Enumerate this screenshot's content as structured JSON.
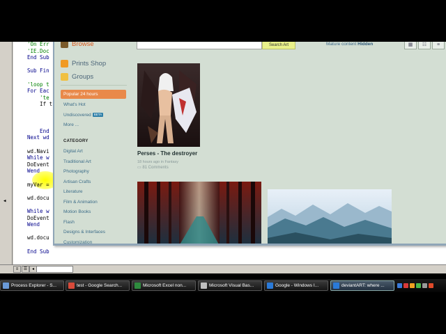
{
  "vba": {
    "lines": [
      {
        "text": "'On Err",
        "style": "comment"
      },
      {
        "text": "'IE.Doc",
        "style": "comment"
      },
      {
        "text": "End Sub",
        "style": "kw"
      },
      {
        "text": "",
        "style": ""
      },
      {
        "text": "Sub Fin",
        "style": "kw"
      },
      {
        "text": "",
        "style": ""
      },
      {
        "text": "'loop t",
        "style": "comment"
      },
      {
        "text": "For Eac",
        "style": "kw"
      },
      {
        "text": "    'te",
        "style": "comment"
      },
      {
        "text": "    If t",
        "style": ""
      },
      {
        "text": "",
        "style": ""
      },
      {
        "text": "",
        "style": ""
      },
      {
        "text": "",
        "style": ""
      },
      {
        "text": "    End",
        "style": "kw"
      },
      {
        "text": "Next wd",
        "style": "kw"
      },
      {
        "text": "",
        "style": ""
      },
      {
        "text": "wd.Navi",
        "style": ""
      },
      {
        "text": "While w",
        "style": "kw"
      },
      {
        "text": "DoEvent",
        "style": ""
      },
      {
        "text": "Wend",
        "style": "kw"
      },
      {
        "text": "",
        "style": ""
      },
      {
        "text": "myVar =",
        "style": ""
      },
      {
        "text": "",
        "style": ""
      },
      {
        "text": "wd.docu",
        "style": ""
      },
      {
        "text": "",
        "style": ""
      },
      {
        "text": "While w",
        "style": "kw"
      },
      {
        "text": "DoEvent",
        "style": ""
      },
      {
        "text": "Wend",
        "style": "kw"
      },
      {
        "text": "",
        "style": ""
      },
      {
        "text": "wd.docu",
        "style": ""
      },
      {
        "text": "",
        "style": ""
      },
      {
        "text": "End Sub",
        "style": "kw"
      }
    ]
  },
  "browser": {
    "search_button": "Search Art",
    "mature_label": "Mature content",
    "mature_value": "Hidden",
    "nav": {
      "browse": "Browse",
      "prints": "Prints Shop",
      "groups": "Groups"
    },
    "sort": {
      "active": "Popular 24 hours",
      "whats_hot": "What's Hot",
      "undiscovered": "Undiscovered",
      "beta": "BETA",
      "more": "More ..."
    },
    "category_title": "CATEGORY",
    "categories": [
      "Digital Art",
      "Traditional Art",
      "Photography",
      "Artisan Crafts",
      "Literature",
      "Film & Animation",
      "Motion Books",
      "Flash",
      "Designs & Interfaces",
      "Customization"
    ],
    "artwork": {
      "title": "Perses - The destroyer",
      "meta": "18 hours ago in Fantasy",
      "comments": "81 Comments"
    }
  },
  "taskbar": {
    "tasks": [
      {
        "label": "Process Explorer - S...",
        "color": "#6a9ad8",
        "active": false
      },
      {
        "label": "test - Google Search...",
        "color": "#d84a3a",
        "active": false
      },
      {
        "label": "Microsoft Excel non...",
        "color": "#2e8b3e",
        "active": false
      },
      {
        "label": "Microsoft Visual Bas...",
        "color": "#c0c0c0",
        "active": false
      },
      {
        "label": "Google - Windows I...",
        "color": "#2a7ad8",
        "active": false
      },
      {
        "label": "deviantART: where ...",
        "color": "#2a7ad8",
        "active": true
      }
    ]
  },
  "colors": {
    "accent": "#e9894a",
    "link": "#3c6c88",
    "page_bg": "#d3ded3"
  }
}
